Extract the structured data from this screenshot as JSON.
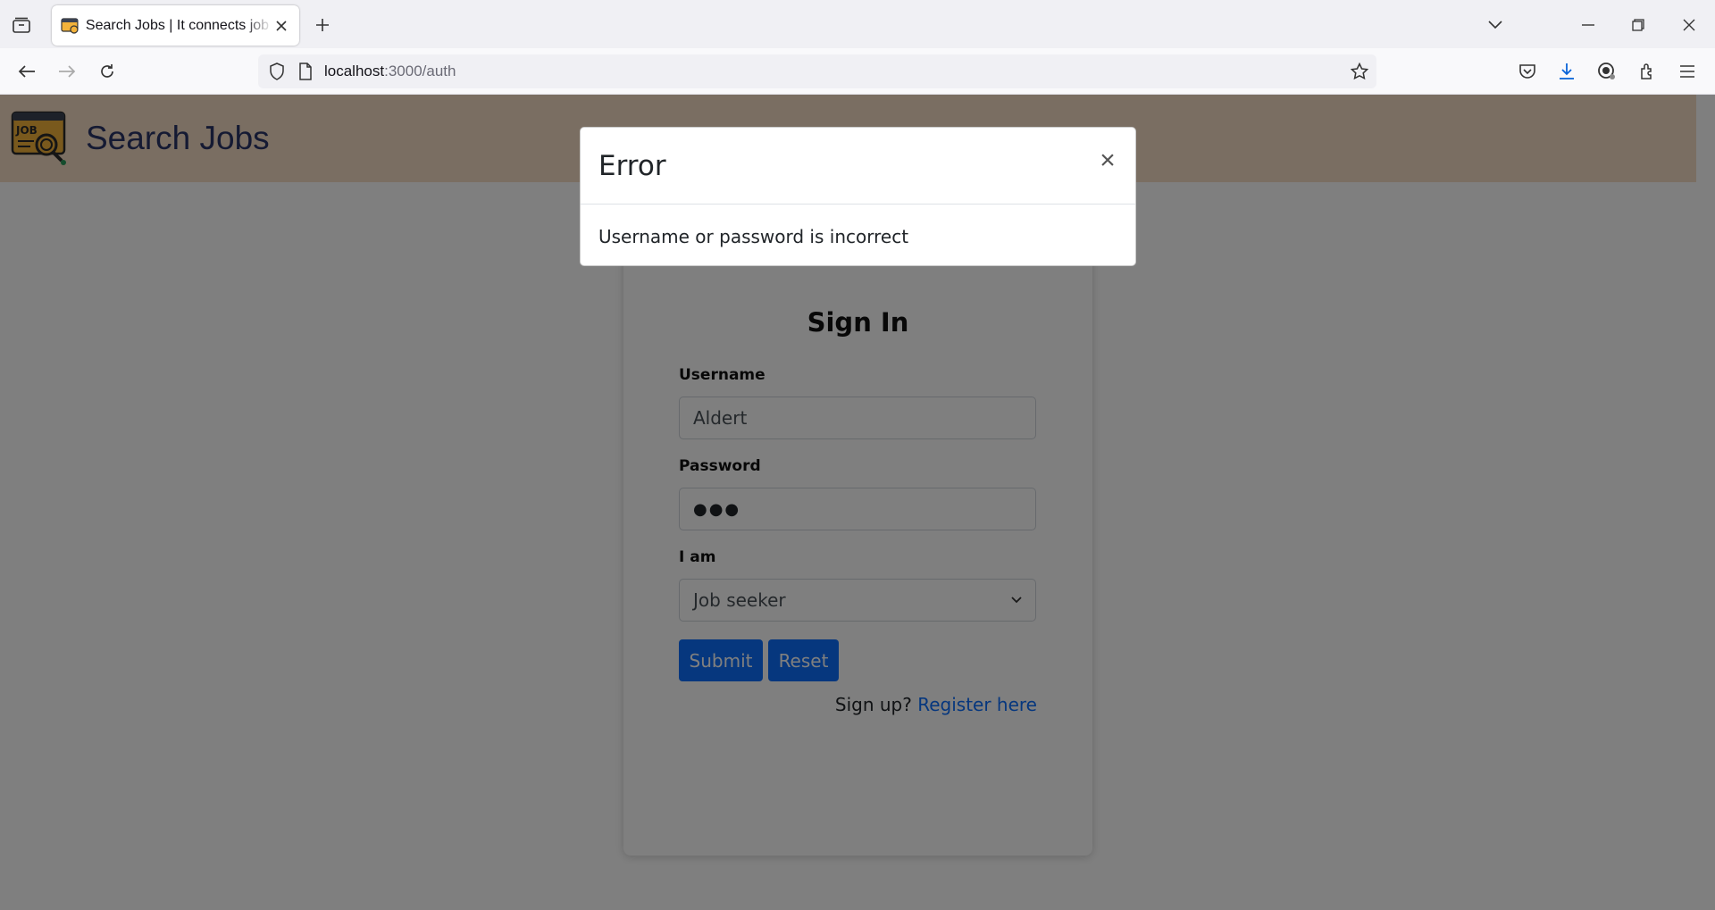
{
  "browser": {
    "tab_title": "Search Jobs | It connects job seekers",
    "url_host": "localhost",
    "url_path": ":3000/auth"
  },
  "header": {
    "app_title": "Search Jobs",
    "logo_text": "JOB"
  },
  "form": {
    "title": "Sign In",
    "username_label": "Username",
    "username_value": "Aldert",
    "password_label": "Password",
    "password_mask": "●●●",
    "role_label": "I am",
    "role_value": "Job seeker",
    "submit_label": "Submit",
    "reset_label": "Reset",
    "signup_prompt": "Sign up?",
    "register_link": "Register here"
  },
  "modal": {
    "title": "Error",
    "close_glyph": "×",
    "message": "Username or password is incorrect"
  },
  "colors": {
    "header_bg": "#f5dcc4",
    "primary": "#0d6efd",
    "title_color": "#2a3566"
  }
}
